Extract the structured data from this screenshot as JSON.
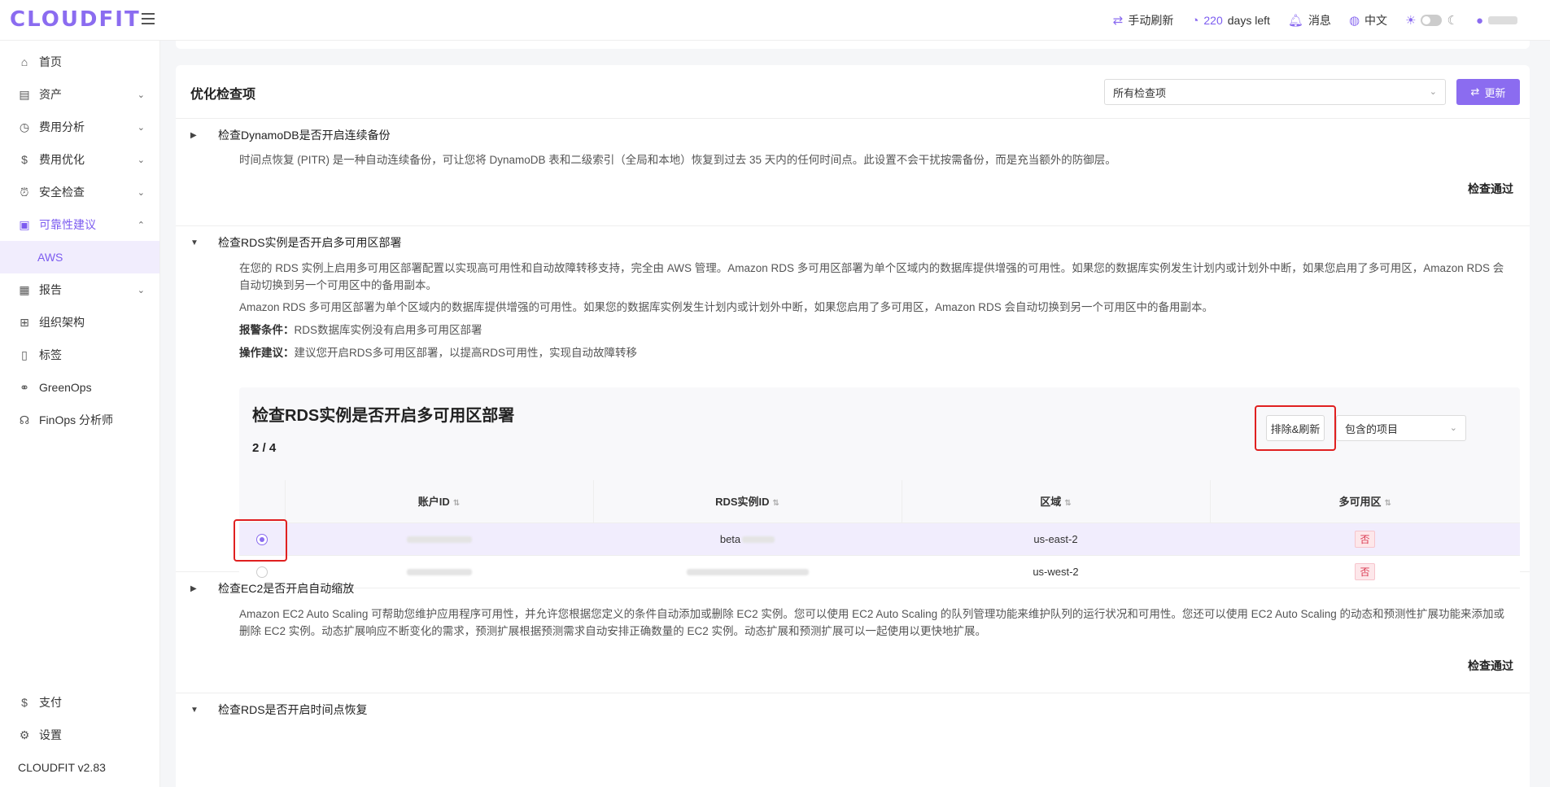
{
  "header": {
    "logo": "CLOUDFIT",
    "refresh_label": "手动刷新",
    "days_num": "220",
    "days_suffix": "days left",
    "messages_label": "消息",
    "lang_label": "中文"
  },
  "sidebar": {
    "items": [
      {
        "label": "首页",
        "icon": "home-icon"
      },
      {
        "label": "资产",
        "icon": "asset-icon"
      },
      {
        "label": "费用分析",
        "icon": "dashboard-icon"
      },
      {
        "label": "费用优化",
        "icon": "dollar-icon"
      },
      {
        "label": "安全检查",
        "icon": "alarm-icon"
      },
      {
        "label": "可靠性建议",
        "icon": "document-icon"
      },
      {
        "label": "AWS"
      },
      {
        "label": "报告",
        "icon": "report-icon"
      },
      {
        "label": "组织架构",
        "icon": "org-icon"
      },
      {
        "label": "标签",
        "icon": "tag-icon"
      },
      {
        "label": "GreenOps",
        "icon": "share-icon"
      },
      {
        "label": "FinOps 分析师",
        "icon": "brain-icon"
      }
    ],
    "bottom": [
      {
        "label": "支付",
        "icon": "dollar-icon"
      },
      {
        "label": "设置",
        "icon": "gear-icon"
      }
    ],
    "version": "CLOUDFIT v2.83"
  },
  "main": {
    "title": "优化检查项",
    "filter_value": "所有检查项",
    "update_label": "更新",
    "checks": [
      {
        "title": "检查DynamoDB是否开启连续备份",
        "desc": "时间点恢复 (PITR) 是一种自动连续备份，可让您将 DynamoDB 表和二级索引（全局和本地）恢复到过去 35 天内的任何时间点。此设置不会干扰按需备份，而是充当额外的防御层。",
        "status": "检查通过"
      },
      {
        "title": "检查RDS实例是否开启多可用区部署",
        "desc1": "在您的 RDS 实例上启用多可用区部署配置以实现高可用性和自动故障转移支持，完全由 AWS 管理。Amazon RDS 多可用区部署为单个区域内的数据库提供增强的可用性。如果您的数据库实例发生计划内或计划外中断，如果您启用了多可用区，Amazon RDS 会自动切换到另一个可用区中的备用副本。",
        "desc2": "Amazon RDS 多可用区部署为单个区域内的数据库提供增强的可用性。如果您的数据库实例发生计划内或计划外中断，如果您启用了多可用区，Amazon RDS 会自动切换到另一个可用区中的备用副本。",
        "alarm_label": "报警条件：",
        "alarm_text": "RDS数据库实例没有启用多可用区部署",
        "advice_label": "操作建议：",
        "advice_text": "建议您开启RDS多可用区部署，以提高RDS可用性，实现自动故障转移",
        "panel": {
          "title": "检查RDS实例是否开启多可用区部署",
          "count": "2 / 4",
          "exclude_label": "排除&刷新",
          "include_value": "包含的项目",
          "columns": [
            "账户ID",
            "RDS实例ID",
            "区域",
            "多可用区"
          ],
          "rows": [
            {
              "selected": true,
              "account": "",
              "rds": "beta",
              "region": "us-east-2",
              "multi_az": "否"
            },
            {
              "selected": false,
              "account": "",
              "rds": "",
              "region": "us-west-2",
              "multi_az": "否"
            }
          ]
        }
      },
      {
        "title": "检查EC2是否开启自动缩放",
        "desc": "Amazon EC2 Auto Scaling 可帮助您维护应用程序可用性，并允许您根据您定义的条件自动添加或删除 EC2 实例。您可以使用 EC2 Auto Scaling 的队列管理功能来维护队列的运行状况和可用性。您还可以使用 EC2 Auto Scaling 的动态和预测性扩展功能来添加或删除 EC2 实例。动态扩展响应不断变化的需求，预测扩展根据预测需求自动安排正确数量的 EC2 实例。动态扩展和预测扩展可以一起使用以更快地扩展。",
        "status": "检查通过"
      },
      {
        "title": "检查RDS是否开启时间点恢复"
      }
    ]
  },
  "colors": {
    "brand": "#8b6cf0",
    "highlight": "#e02020",
    "tag_no": "#d9364f"
  }
}
